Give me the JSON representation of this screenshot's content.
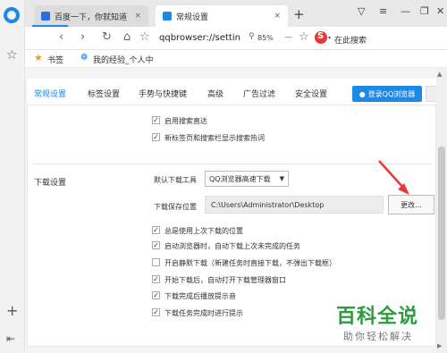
{
  "tabs": [
    {
      "title": "百度一下，你就知道",
      "close": "×"
    },
    {
      "title": "常规设置",
      "close": "×"
    }
  ],
  "new_tab": "+",
  "address": "qqbrowser://settin",
  "zoom": "85%",
  "search_placeholder": "在此搜索",
  "bookmarks": {
    "label": "书签",
    "item": "我的经验_个人中"
  },
  "settings_tabs": [
    "常规设置",
    "标签设置",
    "手势与快捷键",
    "高级",
    "广告过滤",
    "安全设置"
  ],
  "login_button": "登录QQ浏览器",
  "top_checkboxes": [
    {
      "label": "启用搜索直达",
      "checked": true
    },
    {
      "label": "新标签页和搜索栏显示搜索热词",
      "checked": true
    }
  ],
  "download": {
    "title": "下载设置",
    "default_tool_label": "默认下载工具",
    "default_tool_value": "QQ浏览器高速下载",
    "save_path_label": "下载保存位置",
    "save_path_value": "C:\\Users\\Administrator\\Desktop",
    "change_button": "更改...",
    "options": [
      {
        "label": "总是使用上次下载的位置",
        "checked": true
      },
      {
        "label": "启动浏览器时，自动下载上次未完成的任务",
        "checked": true
      },
      {
        "label": "开启静默下载（新建任务时直接下载，不弹出下载框）",
        "checked": false
      },
      {
        "label": "开始下载后，自动打开下载管理器窗口",
        "checked": true
      },
      {
        "label": "下载完成后播放提示音",
        "checked": true
      },
      {
        "label": "下载任务完成时进行提示",
        "checked": true
      }
    ]
  },
  "watermark": {
    "main": "百科全说",
    "sub": "助你轻松解决"
  },
  "colors": {
    "accent": "#1e88e5",
    "watermark": "#2e9b3e",
    "arrow": "#e53935"
  }
}
